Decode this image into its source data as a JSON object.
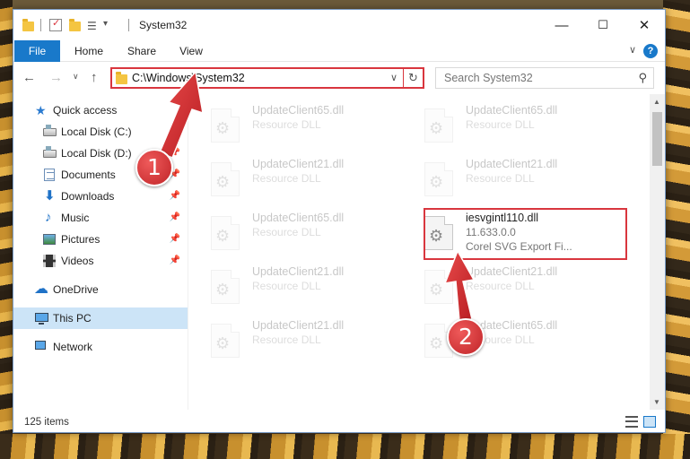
{
  "window": {
    "title": "System32",
    "controls": {
      "minimize": "—",
      "maximize": "☐",
      "close": "✕"
    }
  },
  "ribbon": {
    "tabs": [
      {
        "label": "File"
      },
      {
        "label": "Home"
      },
      {
        "label": "Share"
      },
      {
        "label": "View"
      }
    ],
    "help": "?"
  },
  "address_bar": {
    "path": "C:\\Windows\\System32",
    "search_placeholder": "Search System32"
  },
  "nav_pane": {
    "items": [
      {
        "label": "Quick access"
      },
      {
        "label": "Local Disk (C:)"
      },
      {
        "label": "Local Disk (D:)"
      },
      {
        "label": "Documents"
      },
      {
        "label": "Downloads"
      },
      {
        "label": "Music"
      },
      {
        "label": "Pictures"
      },
      {
        "label": "Videos"
      },
      {
        "label": "OneDrive"
      },
      {
        "label": "This PC"
      },
      {
        "label": "Network"
      }
    ]
  },
  "files": [
    {
      "name": "UpdateClient65.dll",
      "type": "Resource DLL"
    },
    {
      "name": "UpdateClient65.dll",
      "type": "Resource DLL"
    },
    {
      "name": "UpdateClient21.dll",
      "type": "Resource DLL"
    },
    {
      "name": "UpdateClient21.dll",
      "type": "Resource DLL"
    },
    {
      "name": "UpdateClient65.dll",
      "type": "Resource DLL"
    },
    {
      "name": "iesvgintl110.dll",
      "version": "11.633.0.0",
      "description": "Corel SVG Export Fi..."
    },
    {
      "name": "UpdateClient21.dll",
      "type": "Resource DLL"
    },
    {
      "name": "UpdateClient21.dll",
      "type": "Resource DLL"
    },
    {
      "name": "UpdateClient21.dll",
      "type": "Resource DLL"
    },
    {
      "name": "UpdateClient65.dll",
      "type": "Resource DLL"
    }
  ],
  "status": {
    "item_count": "125 items"
  },
  "callouts": {
    "step1": "1",
    "step2": "2"
  },
  "colors": {
    "accent": "#1979ca",
    "highlight": "#d9363e",
    "selected": "#cce4f7"
  }
}
